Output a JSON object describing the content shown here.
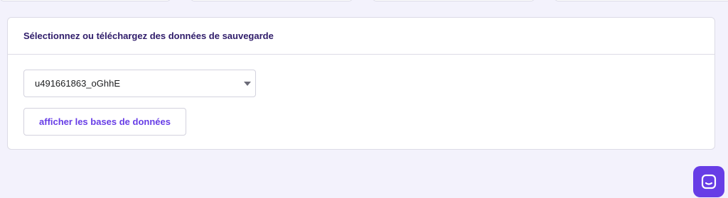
{
  "card": {
    "title": "Sélectionnez ou téléchargez des données de sauvegarde"
  },
  "backup_select": {
    "value": "u491661863_oGhhE"
  },
  "show_databases_button": {
    "label": "afficher les bases de données"
  },
  "icons": {
    "select_caret": "caret-down-icon",
    "chat": "chat-icon"
  },
  "colors": {
    "accent": "#673de6",
    "page_background": "#f3f2fc",
    "title_text": "#2f1c6a"
  }
}
